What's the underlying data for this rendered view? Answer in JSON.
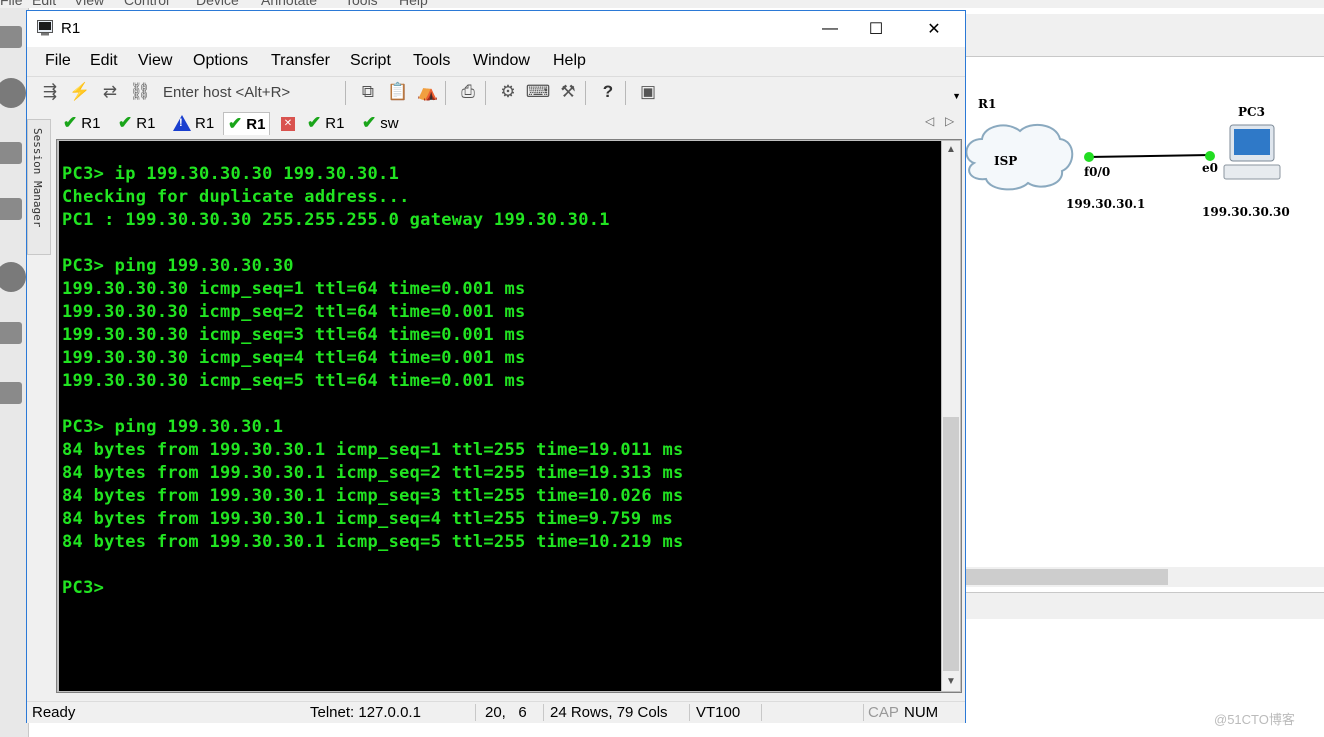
{
  "background_app": {
    "menu": [
      "File",
      "Edit",
      "View",
      "Control",
      "Device",
      "Annotate",
      "Tools",
      "Help"
    ],
    "topology": {
      "router_label": "R1",
      "cloud_label": "ISP",
      "pc_label": "PC3",
      "router_interface": "f0/0",
      "router_ip": "199.30.30.1",
      "pc_interface": "e0",
      "pc_ip": "199.30.30.30",
      "link_color": "#22dd22"
    },
    "watermark": "@51CTO博客"
  },
  "window": {
    "title": "R1",
    "controls": {
      "minimize": "—",
      "maximize": "☐",
      "close": "✕"
    }
  },
  "menu": {
    "file": "File",
    "edit": "Edit",
    "view": "View",
    "options": "Options",
    "transfer": "Transfer",
    "script": "Script",
    "tools": "Tools",
    "window": "Window",
    "help": "Help"
  },
  "toolbar": {
    "host_placeholder": "Enter host <Alt+R>",
    "icons": [
      "connect-icon",
      "quick-connect-icon",
      "reconnect-icon",
      "disconnect-icon",
      "copy-icon",
      "paste-icon",
      "find-icon",
      "print-icon",
      "settings-icon",
      "keymap-icon",
      "sftp-icon",
      "help-icon",
      "about-icon"
    ]
  },
  "tabs": [
    {
      "label": "R1",
      "status": "ok"
    },
    {
      "label": "R1",
      "status": "ok"
    },
    {
      "label": "R1",
      "status": "warning"
    },
    {
      "label": "R1",
      "status": "ok",
      "active": true
    },
    {
      "label": "R1",
      "status": "ok"
    },
    {
      "label": "sw",
      "status": "ok"
    }
  ],
  "session_manager_label": "Session Manager",
  "terminal": {
    "text_color": "#21e421",
    "background": "#000000",
    "lines": [
      "PC3> ip 199.30.30.30 199.30.30.1",
      "Checking for duplicate address...",
      "PC1 : 199.30.30.30 255.255.255.0 gateway 199.30.30.1",
      "",
      "PC3> ping 199.30.30.30",
      "199.30.30.30 icmp_seq=1 ttl=64 time=0.001 ms",
      "199.30.30.30 icmp_seq=2 ttl=64 time=0.001 ms",
      "199.30.30.30 icmp_seq=3 ttl=64 time=0.001 ms",
      "199.30.30.30 icmp_seq=4 ttl=64 time=0.001 ms",
      "199.30.30.30 icmp_seq=5 ttl=64 time=0.001 ms",
      "",
      "PC3> ping 199.30.30.1",
      "84 bytes from 199.30.30.1 icmp_seq=1 ttl=255 time=19.011 ms",
      "84 bytes from 199.30.30.1 icmp_seq=2 ttl=255 time=19.313 ms",
      "84 bytes from 199.30.30.1 icmp_seq=3 ttl=255 time=10.026 ms",
      "84 bytes from 199.30.30.1 icmp_seq=4 ttl=255 time=9.759 ms",
      "84 bytes from 199.30.30.1 icmp_seq=5 ttl=255 time=10.219 ms",
      "",
      "PC3>"
    ]
  },
  "statusbar": {
    "state": "Ready",
    "connection": "Telnet: 127.0.0.1",
    "cursor_position": "20,   6",
    "dimensions": "24 Rows, 79 Cols",
    "emulation": "VT100",
    "cap": "CAP",
    "num": "NUM"
  }
}
